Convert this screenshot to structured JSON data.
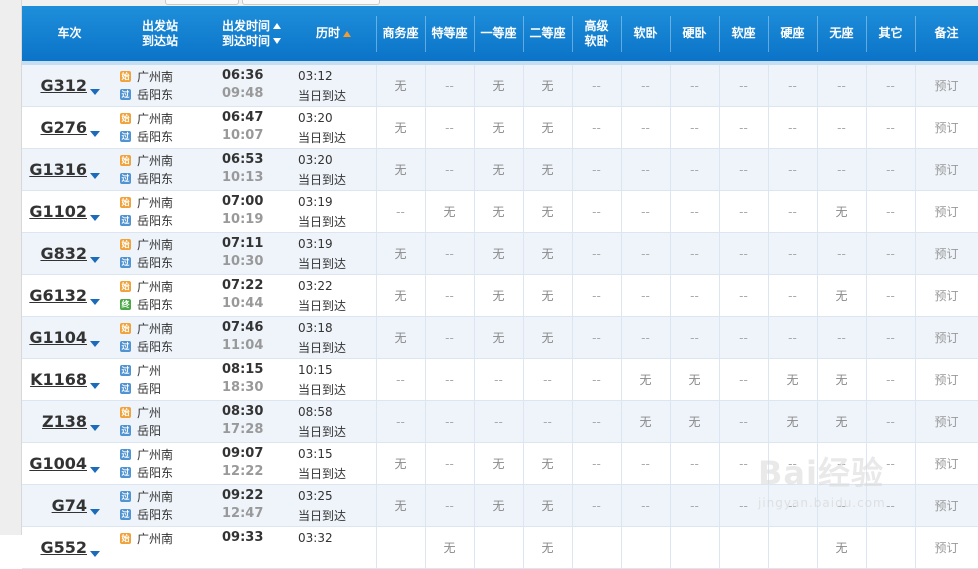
{
  "header": {
    "train": "车次",
    "station_from": "出发站",
    "station_to": "到达站",
    "time_dep": "出发时间",
    "time_arr": "到达时间",
    "duration": "历时",
    "seats": [
      "商务座",
      "特等座",
      "一等座",
      "二等座",
      "高级",
      "软卧",
      "硬卧",
      "软座",
      "硬座",
      "无座",
      "其它"
    ],
    "seat_hi_line2": "软卧",
    "remark": "备注"
  },
  "rows": [
    {
      "no": "G312",
      "from": "广州南",
      "from_tag": "始",
      "to": "岳阳东",
      "to_tag": "过",
      "dep": "06:36",
      "arr": "09:48",
      "dur": "03:12",
      "arrive": "当日到达",
      "seats": [
        "无",
        "--",
        "无",
        "无",
        "--",
        "--",
        "--",
        "--",
        "--",
        "--",
        "--"
      ],
      "remark": "预订"
    },
    {
      "no": "G276",
      "from": "广州南",
      "from_tag": "始",
      "to": "岳阳东",
      "to_tag": "过",
      "dep": "06:47",
      "arr": "10:07",
      "dur": "03:20",
      "arrive": "当日到达",
      "seats": [
        "无",
        "--",
        "无",
        "无",
        "--",
        "--",
        "--",
        "--",
        "--",
        "--",
        "--"
      ],
      "remark": "预订"
    },
    {
      "no": "G1316",
      "from": "广州南",
      "from_tag": "始",
      "to": "岳阳东",
      "to_tag": "过",
      "dep": "06:53",
      "arr": "10:13",
      "dur": "03:20",
      "arrive": "当日到达",
      "seats": [
        "无",
        "--",
        "无",
        "无",
        "--",
        "--",
        "--",
        "--",
        "--",
        "--",
        "--"
      ],
      "remark": "预订"
    },
    {
      "no": "G1102",
      "from": "广州南",
      "from_tag": "始",
      "to": "岳阳东",
      "to_tag": "过",
      "dep": "07:00",
      "arr": "10:19",
      "dur": "03:19",
      "arrive": "当日到达",
      "seats": [
        "--",
        "无",
        "无",
        "无",
        "--",
        "--",
        "--",
        "--",
        "--",
        "无",
        "--"
      ],
      "remark": "预订"
    },
    {
      "no": "G832",
      "from": "广州南",
      "from_tag": "始",
      "to": "岳阳东",
      "to_tag": "过",
      "dep": "07:11",
      "arr": "10:30",
      "dur": "03:19",
      "arrive": "当日到达",
      "seats": [
        "无",
        "--",
        "无",
        "无",
        "--",
        "--",
        "--",
        "--",
        "--",
        "--",
        "--"
      ],
      "remark": "预订"
    },
    {
      "no": "G6132",
      "from": "广州南",
      "from_tag": "始",
      "to": "岳阳东",
      "to_tag": "终",
      "dep": "07:22",
      "arr": "10:44",
      "dur": "03:22",
      "arrive": "当日到达",
      "seats": [
        "无",
        "--",
        "无",
        "无",
        "--",
        "--",
        "--",
        "--",
        "--",
        "无",
        "--"
      ],
      "remark": "预订"
    },
    {
      "no": "G1104",
      "from": "广州南",
      "from_tag": "始",
      "to": "岳阳东",
      "to_tag": "过",
      "dep": "07:46",
      "arr": "11:04",
      "dur": "03:18",
      "arrive": "当日到达",
      "seats": [
        "无",
        "--",
        "无",
        "无",
        "--",
        "--",
        "--",
        "--",
        "--",
        "--",
        "--"
      ],
      "remark": "预订"
    },
    {
      "no": "K1168",
      "from": "广州",
      "from_tag": "过",
      "to": "岳阳",
      "to_tag": "过",
      "dep": "08:15",
      "arr": "18:30",
      "dur": "10:15",
      "arrive": "当日到达",
      "seats": [
        "--",
        "--",
        "--",
        "--",
        "--",
        "无",
        "无",
        "--",
        "无",
        "无",
        "--"
      ],
      "remark": "预订"
    },
    {
      "no": "Z138",
      "from": "广州",
      "from_tag": "始",
      "to": "岳阳",
      "to_tag": "过",
      "dep": "08:30",
      "arr": "17:28",
      "dur": "08:58",
      "arrive": "当日到达",
      "seats": [
        "--",
        "--",
        "--",
        "--",
        "--",
        "无",
        "无",
        "--",
        "无",
        "无",
        "--"
      ],
      "remark": "预订"
    },
    {
      "no": "G1004",
      "from": "广州南",
      "from_tag": "过",
      "to": "岳阳东",
      "to_tag": "过",
      "dep": "09:07",
      "arr": "12:22",
      "dur": "03:15",
      "arrive": "当日到达",
      "seats": [
        "无",
        "--",
        "无",
        "无",
        "--",
        "--",
        "--",
        "--",
        "--",
        "--",
        "--"
      ],
      "remark": "预订"
    },
    {
      "no": "G74",
      "from": "广州南",
      "from_tag": "过",
      "to": "岳阳东",
      "to_tag": "过",
      "dep": "09:22",
      "arr": "12:47",
      "dur": "03:25",
      "arrive": "当日到达",
      "seats": [
        "无",
        "--",
        "无",
        "无",
        "--",
        "--",
        "--",
        "--",
        "--",
        "--",
        "--"
      ],
      "remark": "预订"
    },
    {
      "no": "G552",
      "from": "广州南",
      "from_tag": "始",
      "to": "",
      "to_tag": "",
      "dep": "09:33",
      "arr": "",
      "dur": "03:32",
      "arrive": "",
      "seats": [
        "",
        "无",
        "",
        "无",
        "",
        "",
        "",
        "",
        "",
        "无",
        ""
      ],
      "remark": "预订"
    }
  ],
  "watermark": {
    "text": "Bai经验",
    "url": "jingyan.baidu.com"
  },
  "colors": {
    "header": "#0b73c8",
    "start_badge": "#f0a33a",
    "pass_badge": "#4f93d2",
    "end_badge": "#4aa847"
  }
}
